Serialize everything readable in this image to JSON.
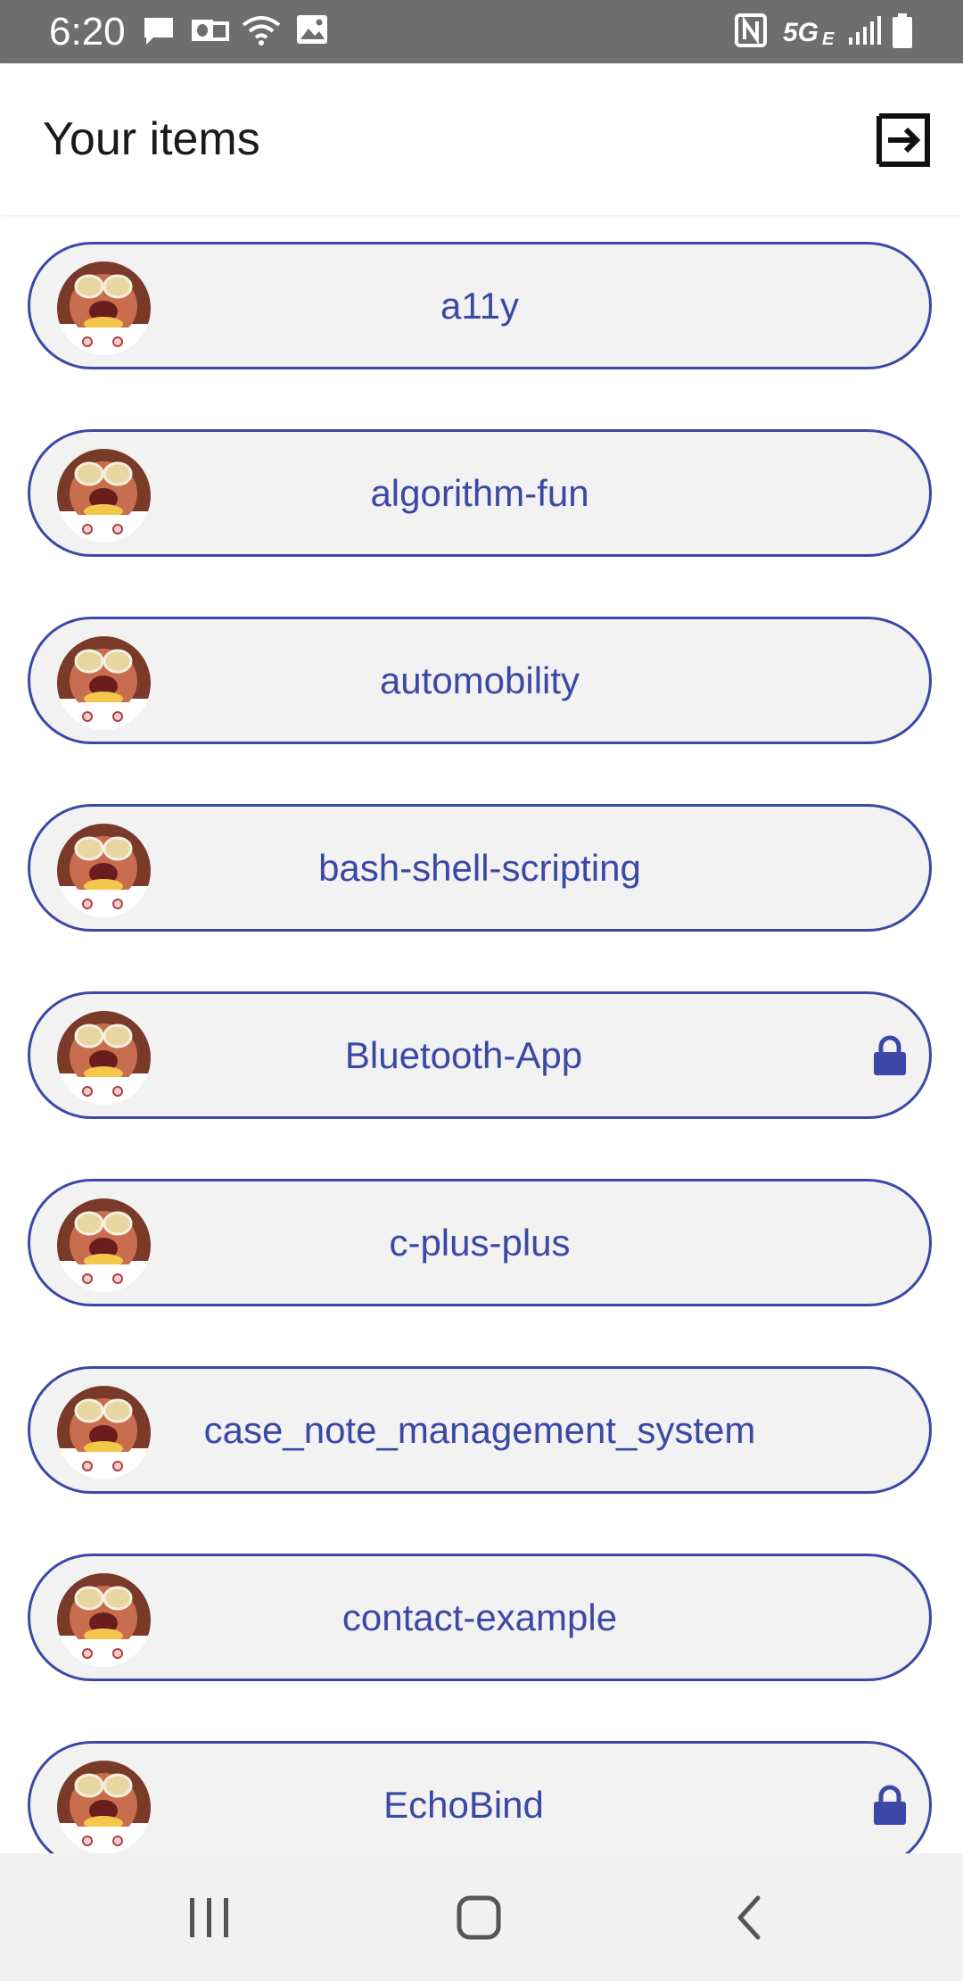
{
  "status_bar": {
    "time": "6:20",
    "icons": [
      "message-icon",
      "outlook-icon",
      "wifi-icon",
      "image-icon",
      "nfc-icon",
      "5g-icon",
      "signal-icon",
      "battery-icon"
    ],
    "network": "5GE"
  },
  "header": {
    "title": "Your items",
    "logout_icon": "logout-icon"
  },
  "items": [
    {
      "label": "a11y",
      "locked": false
    },
    {
      "label": "algorithm-fun",
      "locked": false
    },
    {
      "label": "automobility",
      "locked": false
    },
    {
      "label": "bash-shell-scripting",
      "locked": false
    },
    {
      "label": "Bluetooth-App",
      "locked": true
    },
    {
      "label": "c-plus-plus",
      "locked": false
    },
    {
      "label": "case_note_management_system",
      "locked": false
    },
    {
      "label": "contact-example",
      "locked": false
    },
    {
      "label": "EchoBind",
      "locked": true
    }
  ],
  "nav_bar": {
    "buttons": [
      "recent-apps-icon",
      "home-icon",
      "back-icon"
    ]
  },
  "colors": {
    "accent": "#3b48a5",
    "item_background": "#f2f2f3",
    "status_bar": "#6e6e6e",
    "nav_bar": "#f1f1f1"
  }
}
